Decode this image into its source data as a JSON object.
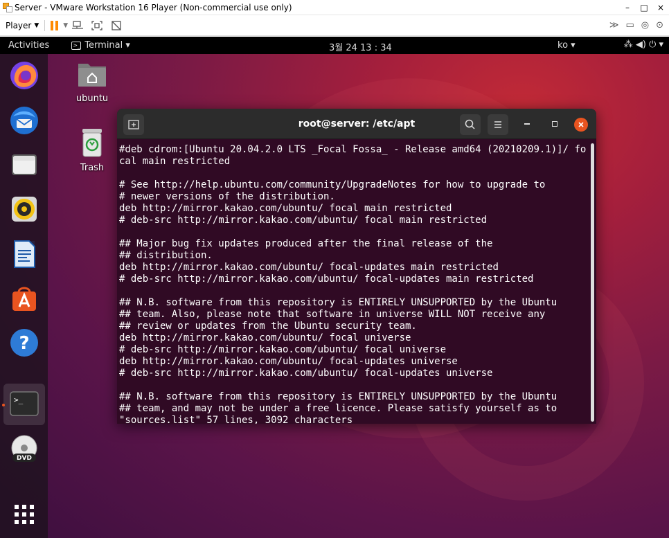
{
  "vmware": {
    "title": "Server - VMware Workstation 16 Player (Non-commercial use only)",
    "window_controls": [
      "–",
      "□",
      "×"
    ],
    "player_label": "Player",
    "toolbar_icons": [
      "pause-icon",
      "send-ctrl-alt-del-icon",
      "fullscreen-icon",
      "unity-icon"
    ],
    "right_icons": [
      "forward-icon",
      "network-adapter-icon",
      "usb-icon",
      "cd-icon"
    ]
  },
  "topbar": {
    "activities": "Activities",
    "app_menu": "Terminal ▾",
    "clock": "3월 24  13 : 34",
    "lang": "ko ▾",
    "system_icons": "⁂  ◀)  ⏻ ▾"
  },
  "desktop": {
    "home_label": "ubuntu",
    "trash_label": "Trash"
  },
  "dock": {
    "items": [
      "firefox-icon",
      "thunderbird-icon",
      "files-icon",
      "rhythmbox-icon",
      "writer-icon",
      "software-icon",
      "help-icon",
      "terminal-icon",
      "dvd-icon",
      "show-apps-icon"
    ]
  },
  "terminal": {
    "title": "root@server: /etc/apt",
    "lines": [
      "#deb cdrom:[Ubuntu 20.04.2.0 LTS _Focal Fossa_ - Release amd64 (20210209.1)]/ fo",
      "cal main restricted",
      "",
      "# See http://help.ubuntu.com/community/UpgradeNotes for how to upgrade to",
      "# newer versions of the distribution.",
      "deb http://mirror.kakao.com/ubuntu/ focal main restricted",
      "# deb-src http://mirror.kakao.com/ubuntu/ focal main restricted",
      "",
      "## Major bug fix updates produced after the final release of the",
      "## distribution.",
      "deb http://mirror.kakao.com/ubuntu/ focal-updates main restricted",
      "# deb-src http://mirror.kakao.com/ubuntu/ focal-updates main restricted",
      "",
      "## N.B. software from this repository is ENTIRELY UNSUPPORTED by the Ubuntu",
      "## team. Also, please note that software in universe WILL NOT receive any",
      "## review or updates from the Ubuntu security team.",
      "deb http://mirror.kakao.com/ubuntu/ focal universe",
      "# deb-src http://mirror.kakao.com/ubuntu/ focal universe",
      "deb http://mirror.kakao.com/ubuntu/ focal-updates universe",
      "# deb-src http://mirror.kakao.com/ubuntu/ focal-updates universe",
      "",
      "## N.B. software from this repository is ENTIRELY UNSUPPORTED by the Ubuntu",
      "## team, and may not be under a free licence. Please satisfy yourself as to",
      "\"sources.list\" 57 lines, 3092 characters"
    ]
  },
  "colors": {
    "terminal_bg": "#300a24",
    "ubuntu_orange": "#e95420",
    "vm_pause": "#ff8a00"
  }
}
